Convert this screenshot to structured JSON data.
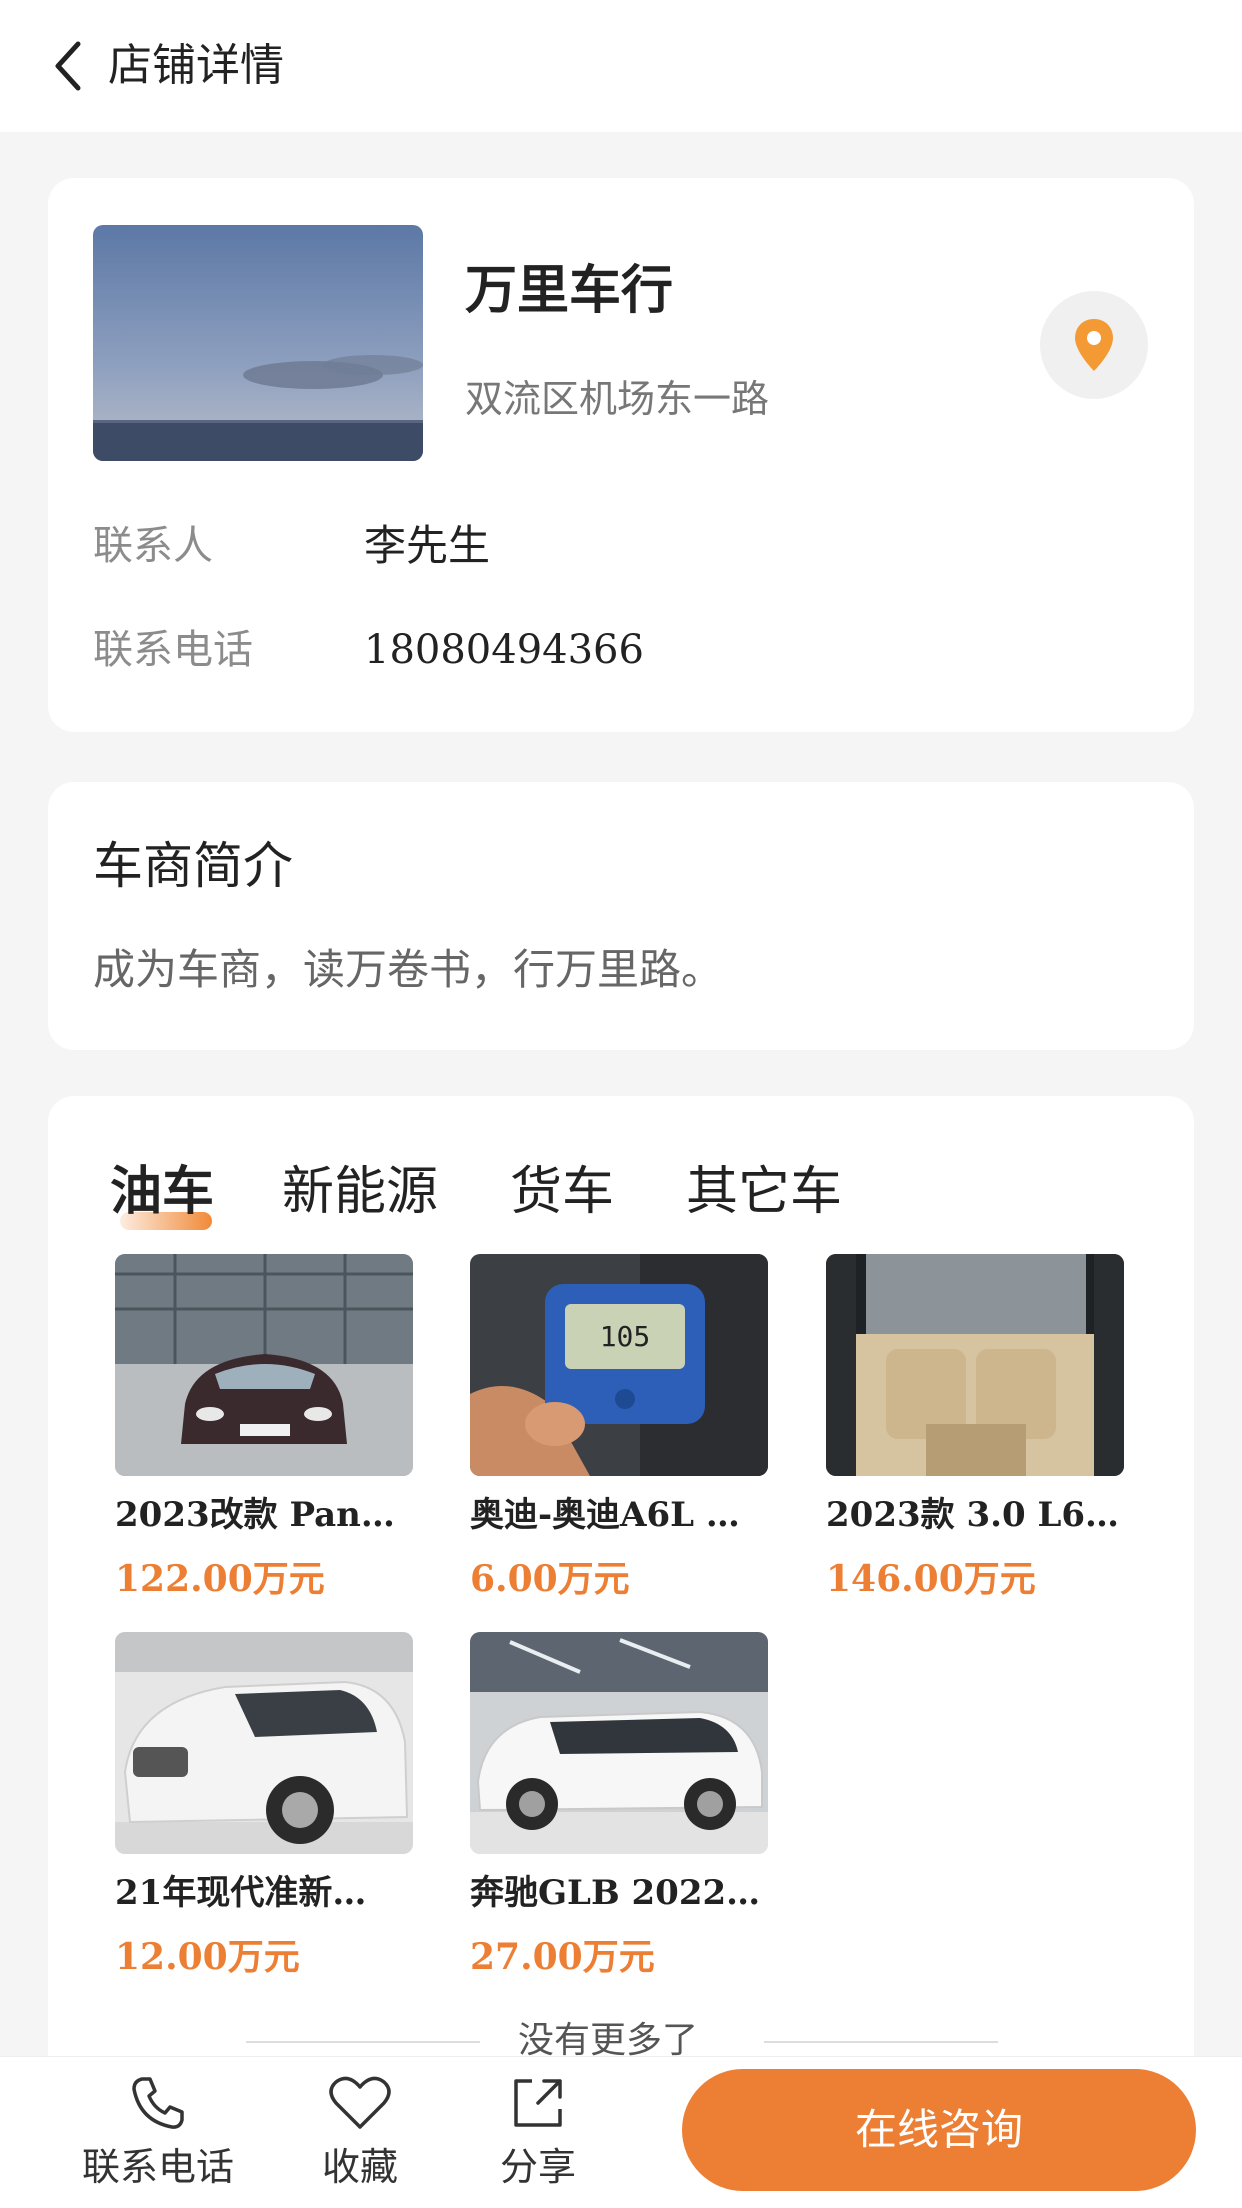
{
  "header": {
    "title": "店铺详情",
    "back_icon": "chevron-left-icon"
  },
  "shop": {
    "name": "万里车行",
    "address": "双流区机场东一路",
    "location_icon": "map-pin-icon",
    "contact_label": "联系人",
    "contact_value": "李先生",
    "phone_label": "联系电话",
    "phone_value": "18080494366"
  },
  "intro": {
    "heading": "车商简介",
    "text": "成为车商，读万卷书，行万里路。"
  },
  "tabs": [
    {
      "label": "油车",
      "active": true
    },
    {
      "label": "新能源",
      "active": false
    },
    {
      "label": "货车",
      "active": false
    },
    {
      "label": "其它车",
      "active": false
    }
  ],
  "cars": [
    {
      "title": "2023改款 Pana…",
      "price": "122.00万元"
    },
    {
      "title": "奥迪-奥迪A6L …",
      "price": "6.00万元"
    },
    {
      "title": "2023款 3.0 L6 …",
      "price": "146.00万元"
    },
    {
      "title": "21年现代准新…",
      "price": "12.00万元"
    },
    {
      "title": "奔驰GLB 2022…",
      "price": "27.00万元"
    }
  ],
  "list_end_text": "没有更多了",
  "bottom_bar": {
    "phone_label": "联系电话",
    "favorite_label": "收藏",
    "share_label": "分享",
    "consult_label": "在线咨询"
  },
  "colors": {
    "accent": "#ec7f34",
    "background": "#f5f5f6"
  }
}
